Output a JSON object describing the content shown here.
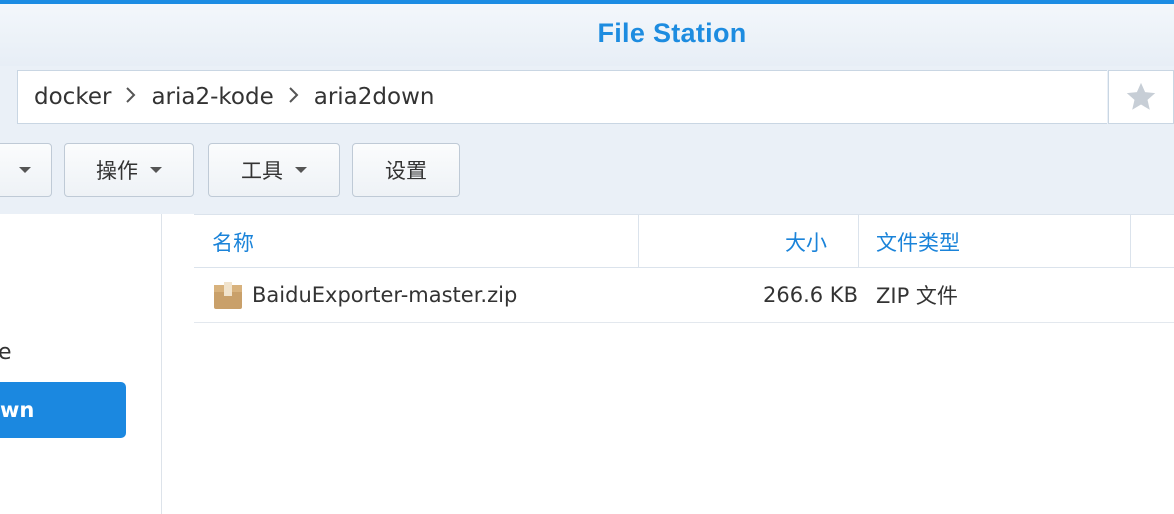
{
  "window": {
    "title": "File Station"
  },
  "breadcrumb": {
    "items": [
      "docker",
      "aria2-kode",
      "aria2down"
    ]
  },
  "toolbar": {
    "operate_label": "操作",
    "tools_label": "工具",
    "settings_label": "设置"
  },
  "sidebar": {
    "items": [
      {
        "label": "e"
      },
      {
        "label": "wn",
        "active": true
      }
    ]
  },
  "file_table": {
    "columns": [
      "名称",
      "大小",
      "文件类型"
    ],
    "rows": [
      {
        "name": "BaiduExporter-master.zip",
        "size": "266.6 KB",
        "type": "ZIP 文件",
        "icon": "archive-icon"
      }
    ]
  },
  "colors": {
    "accent": "#1b8ce3",
    "title": "#1d8ce0",
    "header_text": "#1a83d9"
  }
}
